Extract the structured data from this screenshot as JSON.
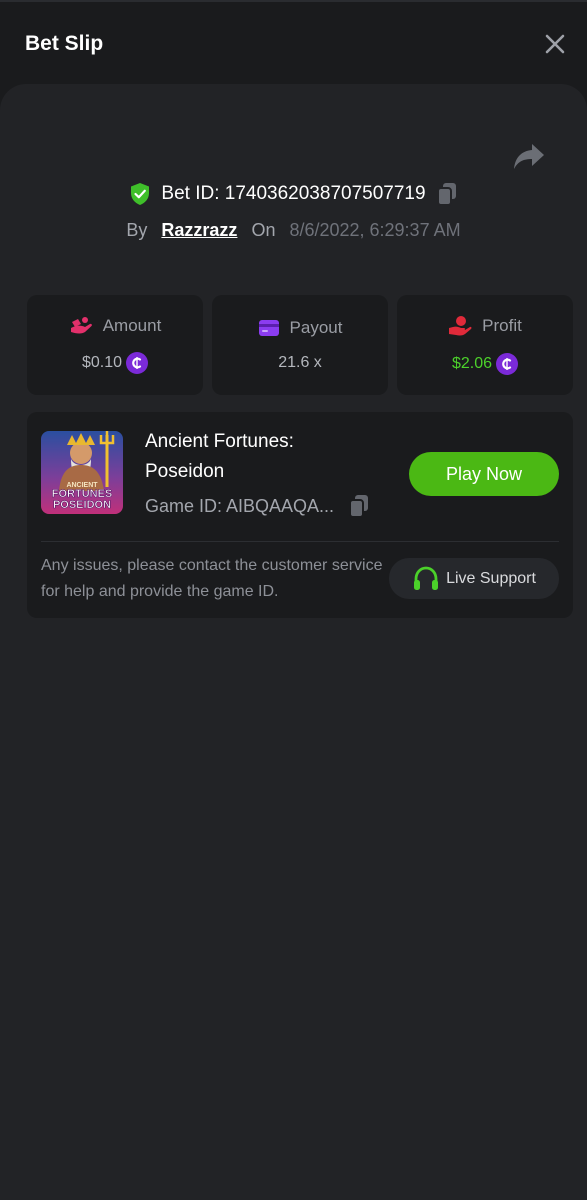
{
  "header": {
    "title": "Bet Slip"
  },
  "bet": {
    "id_label": "Bet ID: 1740362038707507719",
    "by_label": "By",
    "user": "Razzrazz",
    "on_label": "On",
    "date": "8/6/2022, 6:29:37 AM"
  },
  "stats": [
    {
      "label": "Amount",
      "value": "$0.10",
      "icon": "amount-icon",
      "icon_color": "#e3306b"
    },
    {
      "label": "Payout",
      "value": "21.6 x",
      "icon": "card-icon",
      "icon_color": "#8b3cf0"
    },
    {
      "label": "Profit",
      "value": "$2.06",
      "icon": "hand-coin-icon",
      "icon_color": "#e02a3a",
      "value_color": "#4cd12b"
    }
  ],
  "game": {
    "thumb_text_1": "ANCIENT",
    "thumb_text_2": "FORTUNES",
    "thumb_text_3": "POSEIDON",
    "name_line1": "Ancient Fortunes:",
    "name_line2": "Poseidon",
    "game_id": "Game ID: AIBQAAQA...",
    "play_label": "Play Now",
    "notice": "Any issues, please contact the customer service for help and provide the game ID.",
    "support_label": "Live Support"
  },
  "colors": {
    "accent_green": "#4bb814",
    "background": "#1a1b1d",
    "panel": "#222326",
    "coin": "#7b2ad8"
  }
}
